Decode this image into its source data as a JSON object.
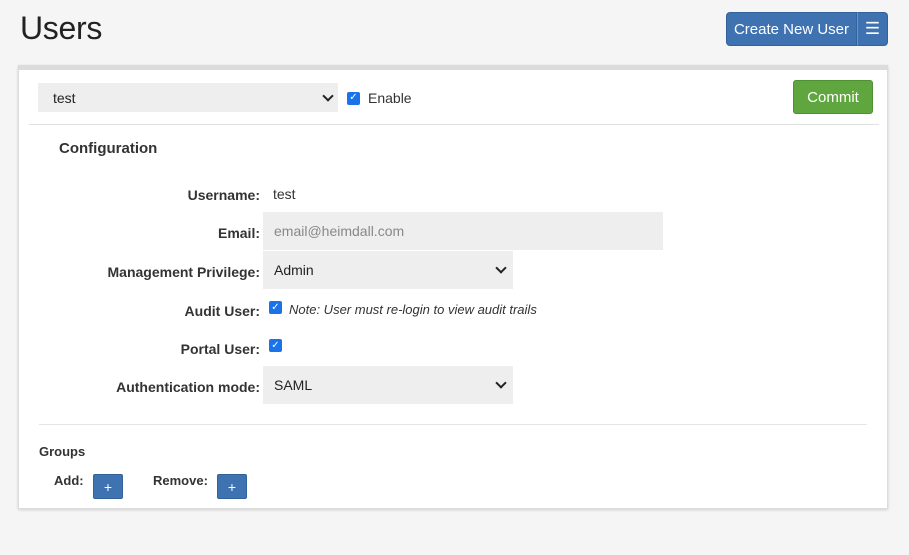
{
  "page": {
    "title": "Users"
  },
  "header": {
    "create_button_label": "Create New User",
    "menu_icon": "☰"
  },
  "toolbar": {
    "user_select_value": "test",
    "enable_label": "Enable",
    "enable_checked": true,
    "commit_label": "Commit"
  },
  "configuration": {
    "heading": "Configuration",
    "username_label": "Username:",
    "username_value": "test",
    "email_label": "Email:",
    "email_placeholder": "email@heimdall.com",
    "privilege_label": "Management Privilege:",
    "privilege_value": "Admin",
    "audit_label": "Audit User:",
    "audit_checked": true,
    "audit_note": "Note: User must re-login to view audit trails",
    "portal_label": "Portal User:",
    "portal_checked": true,
    "auth_label": "Authentication mode:",
    "auth_value": "SAML"
  },
  "groups": {
    "heading": "Groups",
    "add_label": "Add:",
    "remove_label": "Remove:",
    "plus_symbol": "+"
  },
  "colors": {
    "primary": "#3e72b1",
    "success": "#5ea63d",
    "checkbox": "#1a73e8"
  }
}
